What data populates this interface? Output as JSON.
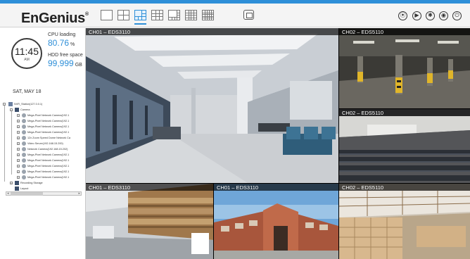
{
  "header": {
    "logo": "EnGenius",
    "logo_mark": "®",
    "layouts": [
      "1x1",
      "2x2",
      "1+5",
      "3x3",
      "1+7",
      "4x4",
      "5x5"
    ],
    "active_layout_index": 2,
    "fullscreen_icon": "fullscreen-icon",
    "right_icons": [
      "location-icon",
      "play-icon",
      "settings-icon",
      "camera-icon",
      "power-icon"
    ]
  },
  "status": {
    "time": "11:45",
    "ampm": "AM",
    "date": "SAT, MAY 18",
    "cpu_label": "CPU loading",
    "cpu_value": "80.76",
    "cpu_unit": "%",
    "hdd_label": "HDD free space",
    "hdd_value": "99,999",
    "hdd_unit": "GB"
  },
  "tree": {
    "root": "NVR_Station(127.0.0.1)",
    "camera_group": "Camera",
    "cameras": [
      "Mega-Pixel Network Camera(192.1",
      "Mega-Pixel Network Camera(192.1",
      "Mega-Pixel Network Camera(192.1",
      "Mega-Pixel Network Camera(192.1",
      "12x Zoom Speed Dome Network Ca",
      "Video Server(192.168.15.200)",
      "Network Camera(192.168.15.202)",
      "Mega-Pixel Network Camera(192.1",
      "Mega-Pixel Network Camera(192.1",
      "Mega-Pixel Network Camera(192.1",
      "Mega-Pixel Network Camera(192.1",
      "Mega-Pixel Network Camera(192.1"
    ],
    "recording_storage": "Recording Storage",
    "layout": "Layout"
  },
  "tiles": [
    {
      "label": "CH01 – EDS3110",
      "scene": "lobby"
    },
    {
      "label": "CH02 – EDS5110",
      "scene": "parking"
    },
    {
      "label": "CH02 – EDS5110",
      "scene": "auditorium"
    },
    {
      "label": "CH01 – EDS3110",
      "scene": "warehouse"
    },
    {
      "label": "CH01 – EDS3110",
      "scene": "building"
    },
    {
      "label": "CH02 – EDS5110",
      "scene": "boxes"
    }
  ],
  "colors": {
    "accent": "#2e8fd8",
    "topbar": "#2e8fd8"
  }
}
